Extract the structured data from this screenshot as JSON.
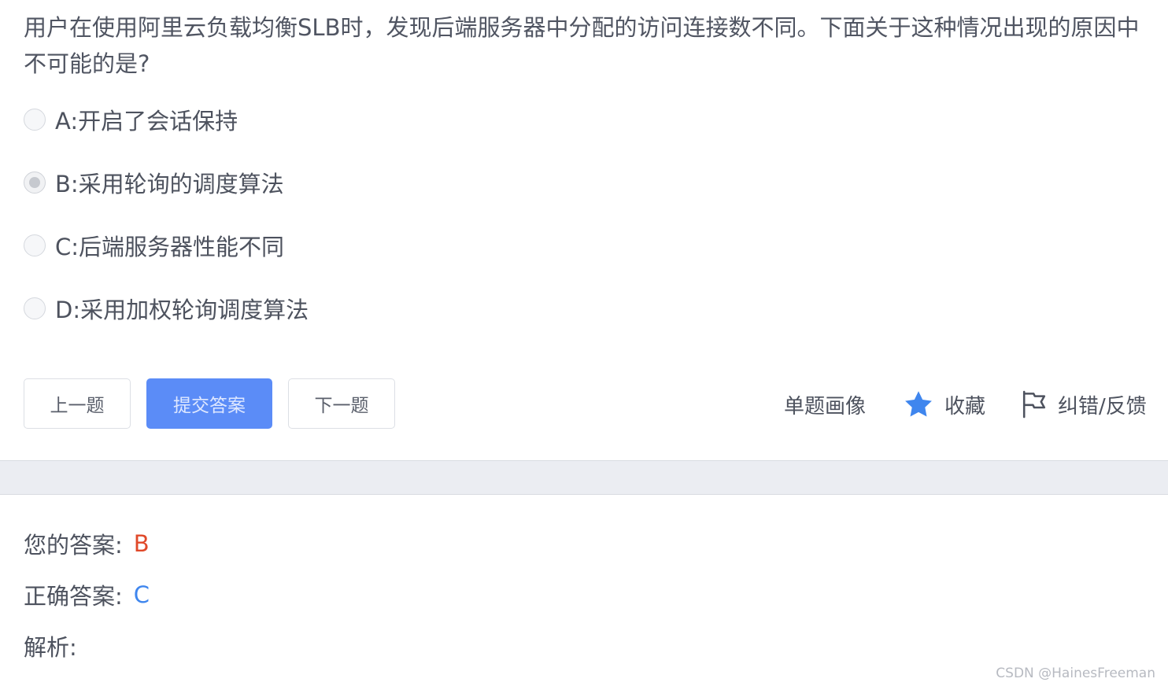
{
  "question": {
    "text": "用户在使用阿里云负载均衡SLB时，发现后端服务器中分配的访问连接数不同。下面关于这种情况出现的原因中不可能的是?"
  },
  "options": [
    {
      "label": "A:开启了会话保持",
      "selected": false
    },
    {
      "label": "B:采用轮询的调度算法",
      "selected": true
    },
    {
      "label": "C:后端服务器性能不同",
      "selected": false
    },
    {
      "label": "D:采用加权轮询调度算法",
      "selected": false
    }
  ],
  "buttons": {
    "prev": "上一题",
    "submit": "提交答案",
    "next": "下一题"
  },
  "actions": {
    "portrait": "单题画像",
    "favorite": "收藏",
    "feedback": "纠错/反馈"
  },
  "icons": {
    "favorite": "star-icon",
    "feedback": "flag-icon"
  },
  "colors": {
    "primary": "#5b8cf7",
    "star": "#3f86ee",
    "wrong_answer": "#e0492a",
    "correct_answer": "#3f86ee"
  },
  "result": {
    "your_answer_label": "您的答案:",
    "your_answer": "B",
    "correct_answer_label": "正确答案:",
    "correct_answer": "C",
    "analysis_label": "解析:"
  },
  "watermark": "CSDN @HainesFreeman"
}
